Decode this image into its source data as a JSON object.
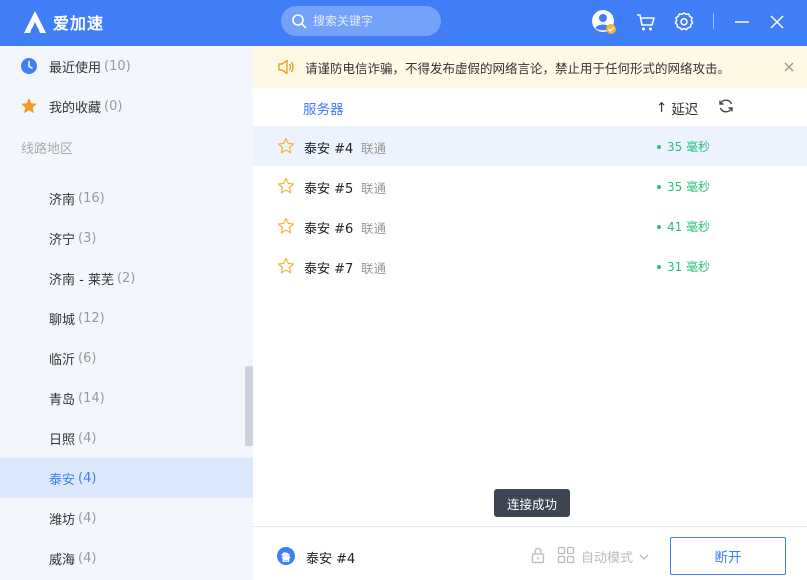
{
  "app": {
    "name": "爱加速"
  },
  "search": {
    "placeholder": "搜索关键字"
  },
  "sidebar": {
    "recent": {
      "label": "最近使用",
      "count": "(10)"
    },
    "favorites": {
      "label": "我的收藏",
      "count": "(0)"
    },
    "section_title": "线路地区",
    "cities": [
      {
        "name": "济南",
        "count": "(16)"
      },
      {
        "name": "济宁",
        "count": "(3)"
      },
      {
        "name": "济南 - 莱芜",
        "count": "(2)"
      },
      {
        "name": "聊城",
        "count": "(12)"
      },
      {
        "name": "临沂",
        "count": "(6)"
      },
      {
        "name": "青岛",
        "count": "(14)"
      },
      {
        "name": "日照",
        "count": "(4)"
      },
      {
        "name": "泰安",
        "count": "(4)"
      },
      {
        "name": "潍坊",
        "count": "(4)"
      },
      {
        "name": "威海",
        "count": "(4)"
      }
    ],
    "active_city": "泰安"
  },
  "notice": {
    "text": "请谨防电信诈骗，不得发布虚假的网络言论，禁止用于任何形式的网络攻击。"
  },
  "list": {
    "col_server": "服务器",
    "col_latency": "延迟",
    "sort_arrow": "↑",
    "rows": [
      {
        "name": "泰安 #4",
        "isp": "联通",
        "latency": "35 毫秒"
      },
      {
        "name": "泰安 #5",
        "isp": "联通",
        "latency": "35 毫秒"
      },
      {
        "name": "泰安 #6",
        "isp": "联通",
        "latency": "41 毫秒"
      },
      {
        "name": "泰安 #7",
        "isp": "联通",
        "latency": "31 毫秒"
      }
    ]
  },
  "toast": {
    "text": "连接成功"
  },
  "bottom": {
    "province_badge": "鲁",
    "current_server": "泰安 #4",
    "mode_label": "自动模式",
    "disconnect_label": "断开"
  },
  "colors": {
    "accent": "#3f7ef7",
    "latency_green": "#2bbf7a",
    "notice_bg": "#fef8e4"
  }
}
